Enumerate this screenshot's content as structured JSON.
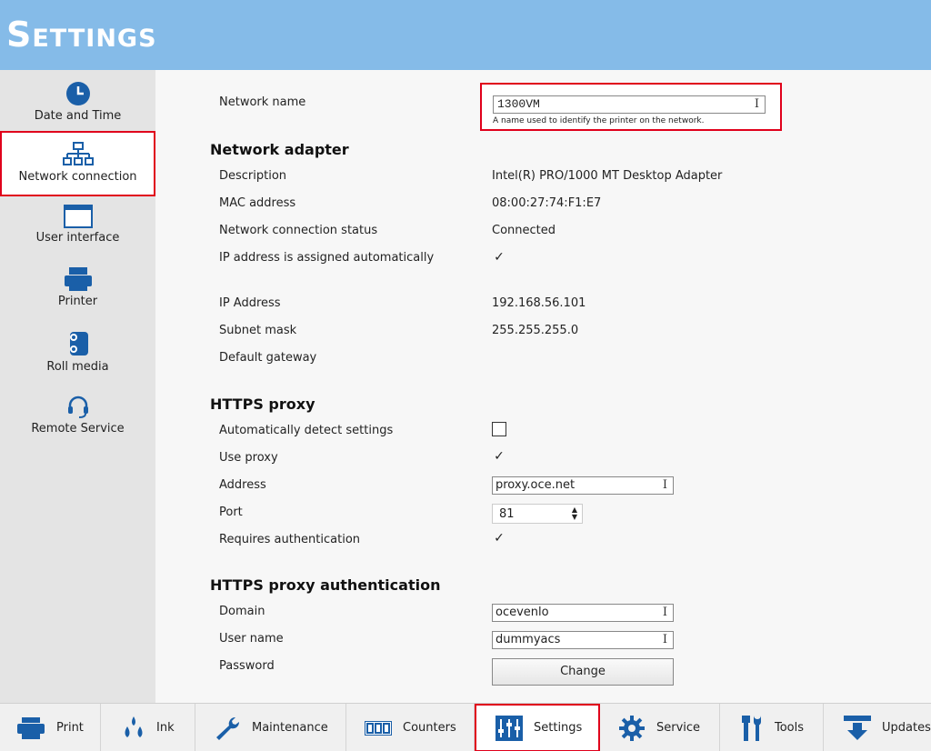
{
  "header": {
    "title": "Settings"
  },
  "sidebar": {
    "items": [
      {
        "label": "Date and Time",
        "icon": "clock-icon"
      },
      {
        "label": "Network connection",
        "icon": "network-icon"
      },
      {
        "label": "User interface",
        "icon": "window-icon"
      },
      {
        "label": "Printer",
        "icon": "printer-icon"
      },
      {
        "label": "Roll media",
        "icon": "roll-media-icon"
      },
      {
        "label": "Remote Service",
        "icon": "headset-icon"
      }
    ]
  },
  "network": {
    "name_label": "Network name",
    "name_value": "1300VM",
    "name_hint": "A name used to identify the printer on the network."
  },
  "adapter": {
    "heading": "Network adapter",
    "description_label": "Description",
    "description_value": "Intel(R) PRO/1000 MT Desktop Adapter",
    "mac_label": "MAC address",
    "mac_value": "08:00:27:74:F1:E7",
    "status_label": "Network connection status",
    "status_value": "Connected",
    "auto_ip_label": "IP address is assigned automatically",
    "auto_ip_checked": true,
    "ip_label": "IP Address",
    "ip_value": "192.168.56.101",
    "subnet_label": "Subnet mask",
    "subnet_value": "255.255.255.0",
    "gateway_label": "Default gateway",
    "gateway_value": ""
  },
  "proxy": {
    "heading": "HTTPS proxy",
    "auto_detect_label": "Automatically detect settings",
    "auto_detect_checked": false,
    "use_proxy_label": "Use proxy",
    "use_proxy_checked": true,
    "address_label": "Address",
    "address_value": "proxy.oce.net",
    "port_label": "Port",
    "port_value": "81",
    "requires_auth_label": "Requires authentication",
    "requires_auth_checked": true
  },
  "proxy_auth": {
    "heading": "HTTPS proxy authentication",
    "domain_label": "Domain",
    "domain_value": "ocevenlo",
    "username_label": "User name",
    "username_value": "dummyacs",
    "password_label": "Password",
    "change_button": "Change"
  },
  "bottom_tabs": [
    {
      "label": "Print",
      "icon": "printer-icon"
    },
    {
      "label": "Ink",
      "icon": "ink-drops-icon"
    },
    {
      "label": "Maintenance",
      "icon": "wrench-icon"
    },
    {
      "label": "Counters",
      "icon": "counter-icon"
    },
    {
      "label": "Settings",
      "icon": "sliders-icon"
    },
    {
      "label": "Service",
      "icon": "gear-icon"
    },
    {
      "label": "Tools",
      "icon": "tools-icon"
    },
    {
      "label": "Updates",
      "icon": "download-icon"
    }
  ],
  "colors": {
    "header": "#85bbe8",
    "accent": "#1a5fa8",
    "highlight": "#e0001b"
  }
}
